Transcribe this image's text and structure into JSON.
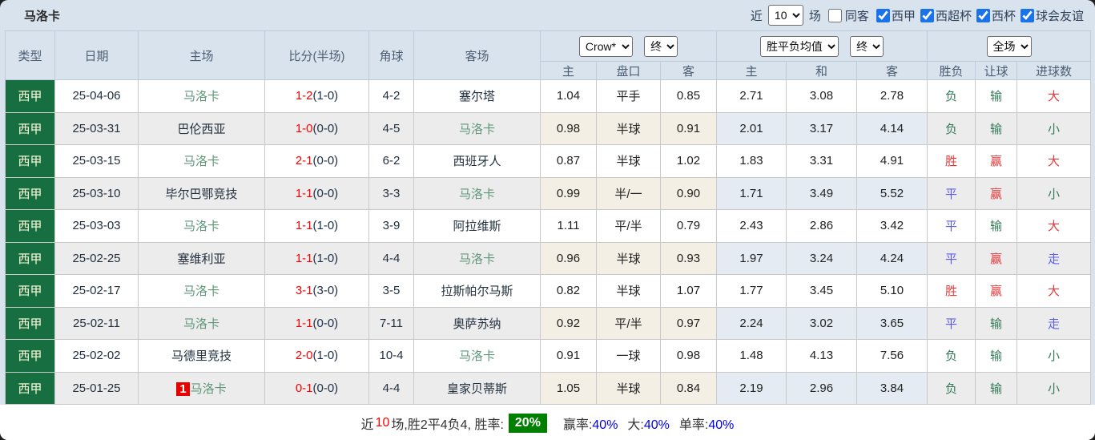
{
  "topbar": {
    "title": "马洛卡",
    "near_label": "近",
    "near_value": "10",
    "games_label": "场",
    "same_opponent_label": "同客",
    "filters": [
      {
        "label": "西甲",
        "checked": true
      },
      {
        "label": "西超杯",
        "checked": true
      },
      {
        "label": "西杯",
        "checked": true
      },
      {
        "label": "球会友谊",
        "checked": true
      }
    ]
  },
  "colors": {
    "league_green": "#176e40",
    "self_team_green": "#5f9779",
    "score_red": "#ff0000",
    "win_red": "#e23a3a",
    "lose_green": "#337a57",
    "draw_blue": "#5b5bee",
    "rate_badge_green": "#008000",
    "checkbox_blue": "#1a73e8"
  },
  "table": {
    "main_headers": [
      "类型",
      "日期",
      "主场",
      "比分(半场)",
      "角球",
      "客场"
    ],
    "dropdowns": {
      "bookmaker": "Crow*",
      "bookmaker_state": "终",
      "avg": "胜平负均值",
      "avg_state": "终",
      "scope": "全场"
    },
    "sub_headers": [
      "主",
      "盘口",
      "客",
      "主",
      "和",
      "客",
      "胜负",
      "让球",
      "进球数"
    ],
    "rows": [
      {
        "league": "西甲",
        "date": "25-04-06",
        "home": "马洛卡",
        "home_self": true,
        "home_badge": null,
        "ft": "1-2",
        "ht": "(1-0)",
        "corners": "4-2",
        "away": "塞尔塔",
        "away_self": false,
        "o_home": "1.04",
        "hcap": "平手",
        "o_away": "0.85",
        "a_home": "2.71",
        "a_draw": "3.08",
        "a_away": "2.78",
        "res": "负",
        "hres": "输",
        "gres": "大"
      },
      {
        "league": "西甲",
        "date": "25-03-31",
        "home": "巴伦西亚",
        "home_self": false,
        "home_badge": null,
        "ft": "1-0",
        "ht": "(0-0)",
        "corners": "4-5",
        "away": "马洛卡",
        "away_self": true,
        "o_home": "0.98",
        "hcap": "半球",
        "o_away": "0.91",
        "a_home": "2.01",
        "a_draw": "3.17",
        "a_away": "4.14",
        "res": "负",
        "hres": "输",
        "gres": "小"
      },
      {
        "league": "西甲",
        "date": "25-03-15",
        "home": "马洛卡",
        "home_self": true,
        "home_badge": null,
        "ft": "2-1",
        "ht": "(0-0)",
        "corners": "6-2",
        "away": "西班牙人",
        "away_self": false,
        "o_home": "0.87",
        "hcap": "半球",
        "o_away": "1.02",
        "a_home": "1.83",
        "a_draw": "3.31",
        "a_away": "4.91",
        "res": "胜",
        "hres": "赢",
        "gres": "大"
      },
      {
        "league": "西甲",
        "date": "25-03-10",
        "home": "毕尔巴鄂竞技",
        "home_self": false,
        "home_badge": null,
        "ft": "1-1",
        "ht": "(0-0)",
        "corners": "3-3",
        "away": "马洛卡",
        "away_self": true,
        "o_home": "0.99",
        "hcap": "半/一",
        "o_away": "0.90",
        "a_home": "1.71",
        "a_draw": "3.49",
        "a_away": "5.52",
        "res": "平",
        "hres": "赢",
        "gres": "小"
      },
      {
        "league": "西甲",
        "date": "25-03-03",
        "home": "马洛卡",
        "home_self": true,
        "home_badge": null,
        "ft": "1-1",
        "ht": "(1-0)",
        "corners": "3-9",
        "away": "阿拉维斯",
        "away_self": false,
        "o_home": "1.11",
        "hcap": "平/半",
        "o_away": "0.79",
        "a_home": "2.43",
        "a_draw": "2.86",
        "a_away": "3.42",
        "res": "平",
        "hres": "输",
        "gres": "大"
      },
      {
        "league": "西甲",
        "date": "25-02-25",
        "home": "塞维利亚",
        "home_self": false,
        "home_badge": null,
        "ft": "1-1",
        "ht": "(1-0)",
        "corners": "4-4",
        "away": "马洛卡",
        "away_self": true,
        "o_home": "0.96",
        "hcap": "半球",
        "o_away": "0.93",
        "a_home": "1.97",
        "a_draw": "3.24",
        "a_away": "4.24",
        "res": "平",
        "hres": "赢",
        "gres": "走"
      },
      {
        "league": "西甲",
        "date": "25-02-17",
        "home": "马洛卡",
        "home_self": true,
        "home_badge": null,
        "ft": "3-1",
        "ht": "(3-0)",
        "corners": "3-5",
        "away": "拉斯帕尔马斯",
        "away_self": false,
        "o_home": "0.82",
        "hcap": "半球",
        "o_away": "1.07",
        "a_home": "1.77",
        "a_draw": "3.45",
        "a_away": "5.10",
        "res": "胜",
        "hres": "赢",
        "gres": "大"
      },
      {
        "league": "西甲",
        "date": "25-02-11",
        "home": "马洛卡",
        "home_self": true,
        "home_badge": null,
        "ft": "1-1",
        "ht": "(0-0)",
        "corners": "7-11",
        "away": "奥萨苏纳",
        "away_self": false,
        "o_home": "0.92",
        "hcap": "平/半",
        "o_away": "0.97",
        "a_home": "2.24",
        "a_draw": "3.02",
        "a_away": "3.65",
        "res": "平",
        "hres": "输",
        "gres": "走"
      },
      {
        "league": "西甲",
        "date": "25-02-02",
        "home": "马德里竞技",
        "home_self": false,
        "home_badge": null,
        "ft": "2-0",
        "ht": "(1-0)",
        "corners": "10-4",
        "away": "马洛卡",
        "away_self": true,
        "o_home": "0.91",
        "hcap": "一球",
        "o_away": "0.98",
        "a_home": "1.48",
        "a_draw": "4.13",
        "a_away": "7.56",
        "res": "负",
        "hres": "输",
        "gres": "小"
      },
      {
        "league": "西甲",
        "date": "25-01-25",
        "home": "马洛卡",
        "home_self": true,
        "home_badge": "1",
        "ft": "0-1",
        "ht": "(0-0)",
        "corners": "4-4",
        "away": "皇家贝蒂斯",
        "away_self": false,
        "o_home": "1.05",
        "hcap": "半球",
        "o_away": "0.84",
        "a_home": "2.19",
        "a_draw": "2.96",
        "a_away": "3.84",
        "res": "负",
        "hres": "输",
        "gres": "小"
      }
    ]
  },
  "footer": {
    "prefix": "近",
    "count": "10",
    "mid": "场,胜2平4负4, 胜率:",
    "win_rate": "20%",
    "stats": [
      {
        "label": "赢率:",
        "value": "40%"
      },
      {
        "label": "大:",
        "value": "40%"
      },
      {
        "label": "单率:",
        "value": "40%"
      }
    ]
  }
}
